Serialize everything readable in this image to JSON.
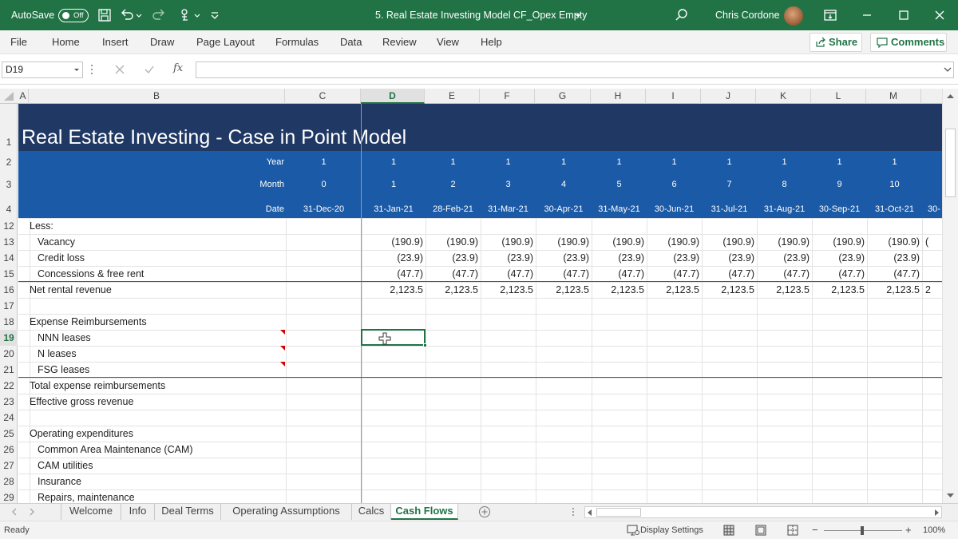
{
  "titlebar": {
    "autosave_label": "AutoSave",
    "autosave_state": "Off",
    "document_title": "5. Real Estate Investing Model CF_Opex Empty",
    "user_name": "Chris Cordone",
    "bg_color": "#217346"
  },
  "menu": {
    "items": [
      "File",
      "Home",
      "Insert",
      "Draw",
      "Page Layout",
      "Formulas",
      "Data",
      "Review",
      "View",
      "Help"
    ],
    "share_label": "Share",
    "comments_label": "Comments"
  },
  "formula_bar": {
    "name_box": "D19",
    "formula": "",
    "fx_label": "fx"
  },
  "columns": [
    "A",
    "B",
    "C",
    "D",
    "E",
    "F",
    "G",
    "H",
    "I",
    "J",
    "K",
    "L",
    "M"
  ],
  "selected_column": "D",
  "sheet": {
    "title": "Real Estate Investing - Case in Point Model",
    "title_bg": "#1f3864",
    "band_bg": "#1b5aa6",
    "header_rows": [
      {
        "row": "2",
        "label": "Year",
        "c": "1",
        "values": [
          "1",
          "1",
          "1",
          "1",
          "1",
          "1",
          "1",
          "1",
          "1",
          "1"
        ]
      },
      {
        "row": "3",
        "label": "Month",
        "c": "0",
        "values": [
          "1",
          "2",
          "3",
          "4",
          "5",
          "6",
          "7",
          "8",
          "9",
          "10"
        ]
      },
      {
        "row": "4",
        "label": "Date",
        "c": "31-Dec-20",
        "values": [
          "31-Jan-21",
          "28-Feb-21",
          "31-Mar-21",
          "30-Apr-21",
          "31-May-21",
          "30-Jun-21",
          "31-Jul-21",
          "31-Aug-21",
          "30-Sep-21",
          "31-Oct-21",
          "30-"
        ]
      }
    ],
    "rows": [
      {
        "row": "12",
        "label": "Less:",
        "indent": false,
        "values": []
      },
      {
        "row": "13",
        "label": "Vacancy",
        "indent": true,
        "values": [
          "(190.9)",
          "(190.9)",
          "(190.9)",
          "(190.9)",
          "(190.9)",
          "(190.9)",
          "(190.9)",
          "(190.9)",
          "(190.9)",
          "(190.9)",
          "("
        ]
      },
      {
        "row": "14",
        "label": "Credit loss",
        "indent": true,
        "values": [
          "(23.9)",
          "(23.9)",
          "(23.9)",
          "(23.9)",
          "(23.9)",
          "(23.9)",
          "(23.9)",
          "(23.9)",
          "(23.9)",
          "(23.9)"
        ]
      },
      {
        "row": "15",
        "label": "Concessions & free rent",
        "indent": true,
        "values": [
          "(47.7)",
          "(47.7)",
          "(47.7)",
          "(47.7)",
          "(47.7)",
          "(47.7)",
          "(47.7)",
          "(47.7)",
          "(47.7)",
          "(47.7)"
        ]
      },
      {
        "row": "16",
        "label": "Net rental revenue",
        "indent": false,
        "values": [
          "2,123.5",
          "2,123.5",
          "2,123.5",
          "2,123.5",
          "2,123.5",
          "2,123.5",
          "2,123.5",
          "2,123.5",
          "2,123.5",
          "2,123.5",
          "2"
        ]
      },
      {
        "row": "17",
        "label": "",
        "indent": false,
        "values": []
      },
      {
        "row": "18",
        "label": "Expense Reimbursements",
        "indent": false,
        "values": []
      },
      {
        "row": "19",
        "label": "NNN leases",
        "indent": true,
        "values": []
      },
      {
        "row": "20",
        "label": "N leases",
        "indent": true,
        "values": []
      },
      {
        "row": "21",
        "label": "FSG leases",
        "indent": true,
        "values": []
      },
      {
        "row": "22",
        "label": "Total expense reimbursements",
        "indent": false,
        "values": []
      },
      {
        "row": "23",
        "label": "Effective gross revenue",
        "indent": false,
        "values": []
      },
      {
        "row": "24",
        "label": "",
        "indent": false,
        "values": []
      },
      {
        "row": "25",
        "label": "Operating expenditures",
        "indent": false,
        "values": []
      },
      {
        "row": "26",
        "label": "Common Area Maintenance (CAM)",
        "indent": true,
        "values": []
      },
      {
        "row": "27",
        "label": "CAM utilities",
        "indent": true,
        "values": []
      },
      {
        "row": "28",
        "label": "Insurance",
        "indent": true,
        "values": []
      },
      {
        "row": "29",
        "label": "Repairs, maintenance",
        "indent": true,
        "values": []
      }
    ]
  },
  "row_numbers": [
    "1",
    "2",
    "3",
    "4",
    "12",
    "13",
    "14",
    "15",
    "16",
    "17",
    "18",
    "19",
    "20",
    "21",
    "22",
    "23",
    "24",
    "25",
    "26",
    "27",
    "28",
    "29"
  ],
  "selected_row": "19",
  "tabs": [
    "Welcome",
    "Info",
    "Deal Terms",
    "Operating Assumptions",
    "Calcs",
    "Cash Flows"
  ],
  "active_tab": "Cash Flows",
  "statusbar": {
    "ready": "Ready",
    "display_settings": "Display Settings",
    "zoom": "100%"
  }
}
